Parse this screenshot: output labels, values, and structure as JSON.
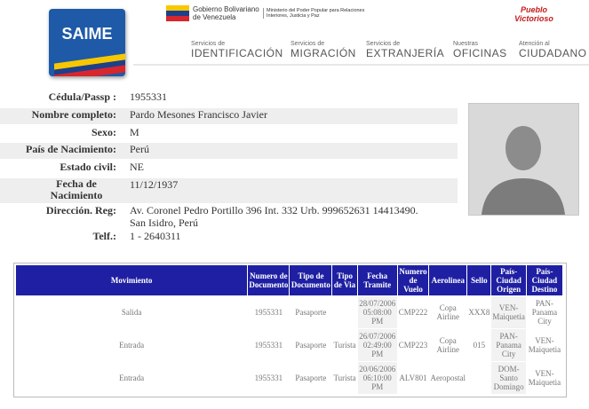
{
  "header": {
    "logo_text": "SAIME",
    "gov_line1": "Gobierno Bolivariano",
    "gov_line2": "de Venezuela",
    "gov_ministry": "Ministerio del Poder Popular para Relaciones Interiores, Justicia y Paz",
    "pueblo": "Pueblo Victorioso",
    "colors": {
      "logo_blue": "#1e5aa8",
      "flag_yellow": "#f7c800",
      "flag_blue": "#1e3f8a",
      "flag_red": "#d7262d",
      "table_header": "#1f1fa3"
    }
  },
  "nav": [
    {
      "small": "Servicios de",
      "big": "IDENTIFICACIÓN"
    },
    {
      "small": "Servicios de",
      "big": "MIGRACIÓN"
    },
    {
      "small": "Servicios de",
      "big": "EXTRANJERÍA"
    },
    {
      "small": "Nuestras",
      "big": "OFICINAS"
    },
    {
      "small": "Atención al",
      "big": "CIUDADANO"
    }
  ],
  "person": {
    "cedula_label": "Cédula/Passp :",
    "cedula": "1955331",
    "nombre_label": "Nombre completo:",
    "nombre": "Pardo Mesones Francisco Javier",
    "sexo_label": "Sexo:",
    "sexo": "M",
    "pais_label": "País de Nacimiento:",
    "pais": "Perú",
    "estado_label": "Estado civil:",
    "estado": "NE",
    "fecha_label": "Fecha de Nacimiento",
    "fecha": "11/12/1937",
    "dir_label": "Dirección. Reg:",
    "dir_line1": "Av.  Coronel Pedro Portillo 396 Int. 332 Urb. 999652631 14413490.",
    "dir_line2": "San Isidro, Perú",
    "telf_label": "Telf.:",
    "telf": "1 - 2640311",
    "photo_icon": "person-silhouette-icon"
  },
  "movements": {
    "headers": [
      "Movimiento",
      "Numero de Documento",
      "Tipo de Documento",
      "Tipo de Via",
      "Fecha Tramite",
      "Numero de Vuelo",
      "Aerolinea",
      "Sello",
      "País-Ciudad Origen",
      "País-Ciudad Destino"
    ],
    "rows": [
      [
        "Salida",
        "1955331",
        "Pasaporte",
        "",
        "28/07/2006 05:08:00 PM",
        "CMP222",
        "Copa Airline",
        "XXX8",
        "VEN-Maiquetia",
        "PAN-Panama City"
      ],
      [
        "Entrada",
        "1955331",
        "Pasaporte",
        "Turista",
        "26/07/2006 02:49:00 PM",
        "CMP223",
        "Copa Airline",
        "015",
        "PAN-Panama City",
        "VEN-Maiquetia"
      ],
      [
        "Entrada",
        "1955331",
        "Pasaporte",
        "Turista",
        "20/06/2006 06:10:00 PM",
        "ALV801",
        "Aeropostal",
        "",
        "DOM-Santo Domingo",
        "VEN-Maiquetia"
      ]
    ]
  }
}
